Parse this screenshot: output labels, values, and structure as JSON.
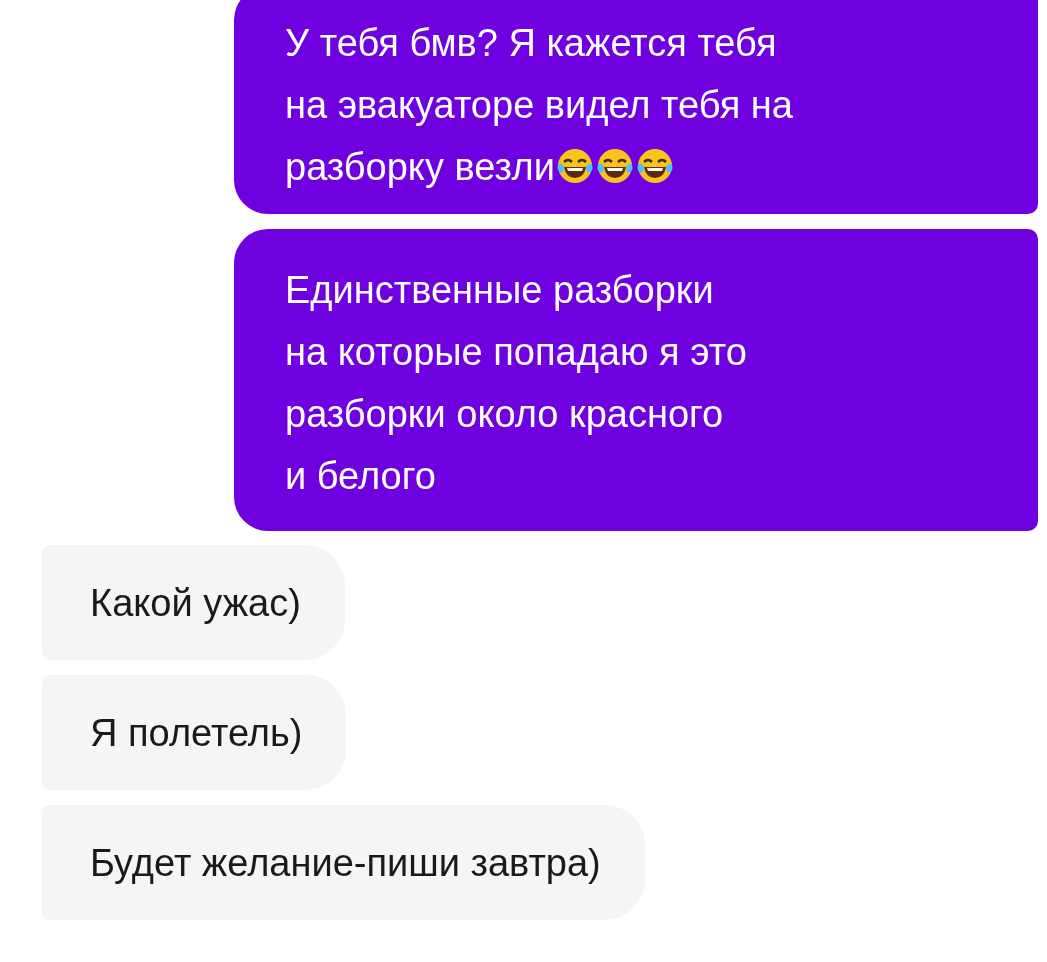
{
  "messages": [
    {
      "kind": "outgoing",
      "lines": [
        "У тебя бмв? Я кажется тебя",
        "на эвакуаторе видел тебя на",
        "разборку везли"
      ],
      "emoji": [
        {
          "kind": "tears-of-joy"
        },
        {
          "kind": "tears-of-joy"
        },
        {
          "kind": "tears-of-joy"
        }
      ]
    },
    {
      "kind": "outgoing",
      "lines": [
        "Единственные разборки",
        "на которые попадаю я это",
        "разборки около красного",
        "и белого"
      ]
    },
    {
      "kind": "incoming",
      "lines": [
        "Какой ужас)"
      ]
    },
    {
      "kind": "incoming",
      "lines": [
        "Я полетель)"
      ]
    },
    {
      "kind": "incoming",
      "lines": [
        "Будет желание-пиши завтра)"
      ]
    }
  ]
}
